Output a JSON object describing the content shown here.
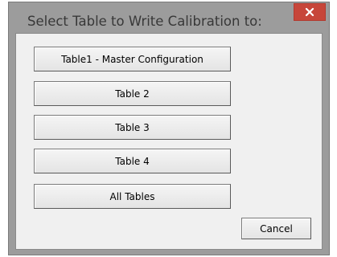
{
  "dialog": {
    "title": "Select Table to Write Calibration to:",
    "close_symbol": "✕"
  },
  "buttons": {
    "table1": "Table1 - Master Configuration",
    "table2": "Table 2",
    "table3": "Table 3",
    "table4": "Table 4",
    "all_tables": "All Tables",
    "cancel": "Cancel"
  },
  "colors": {
    "frame": "#9c9c9c",
    "close_button": "#c7463a",
    "client_background": "#f0f0f0"
  },
  "icons": {
    "close": "close-icon"
  }
}
